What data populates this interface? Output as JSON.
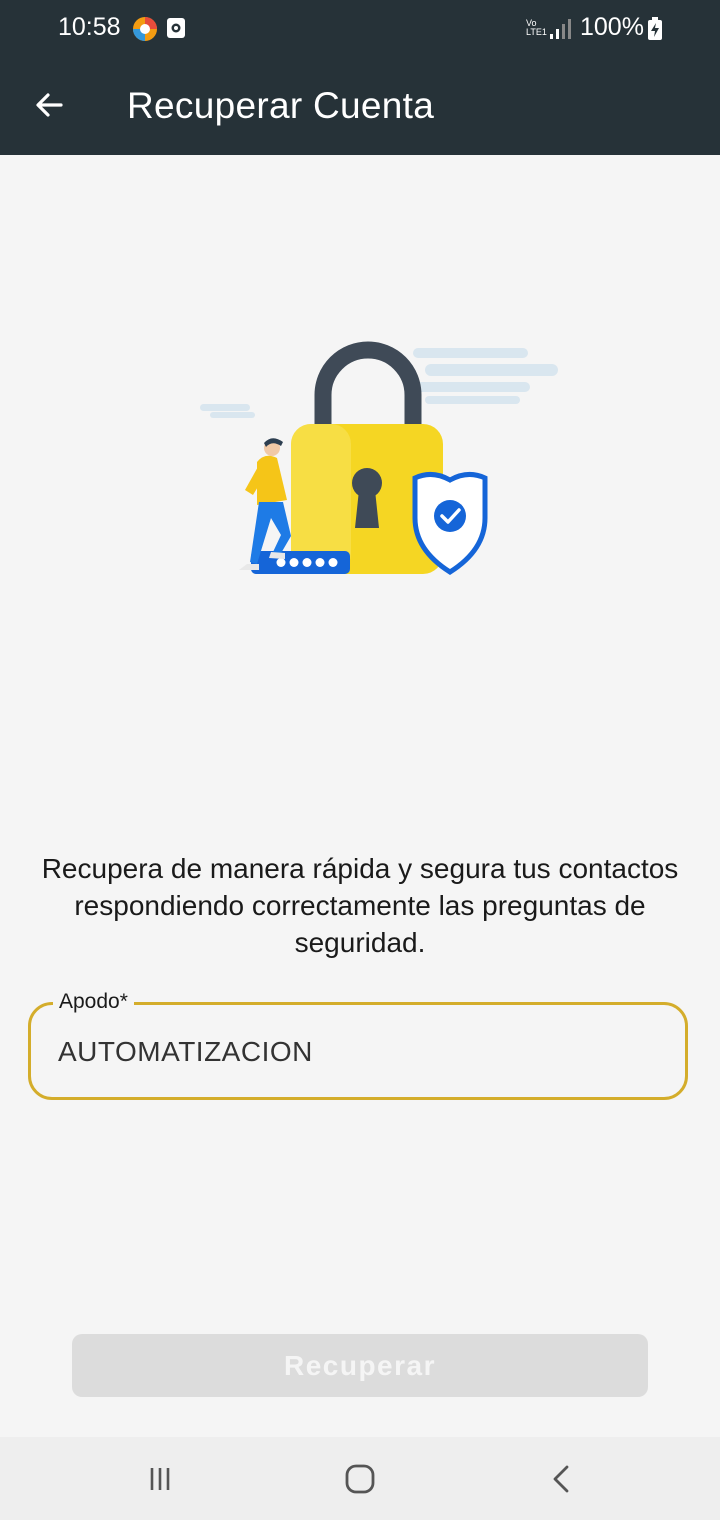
{
  "status": {
    "time": "10:58",
    "network": "Vo\nLTE1",
    "battery": "100%"
  },
  "app_bar": {
    "title": "Recuperar Cuenta",
    "back_icon": "arrow-left-icon"
  },
  "illustration": {
    "icon": "lock-security-illustration",
    "colors": {
      "lock": "#f5d623",
      "shackle": "#3f4a57",
      "shield": "#1565d8"
    }
  },
  "description": "Recupera de manera rápida y segura tus contactos respondiendo correctamente las preguntas de seguridad.",
  "form": {
    "nickname_label": "Apodo*",
    "nickname_value": "AUTOMATIZACION",
    "accent_color": "#d4ad2b"
  },
  "submit": {
    "label": "Recuperar",
    "enabled": false
  },
  "nav": {
    "recent_icon": "recent-apps-icon",
    "home_icon": "home-icon",
    "back_icon": "back-chevron-icon"
  }
}
